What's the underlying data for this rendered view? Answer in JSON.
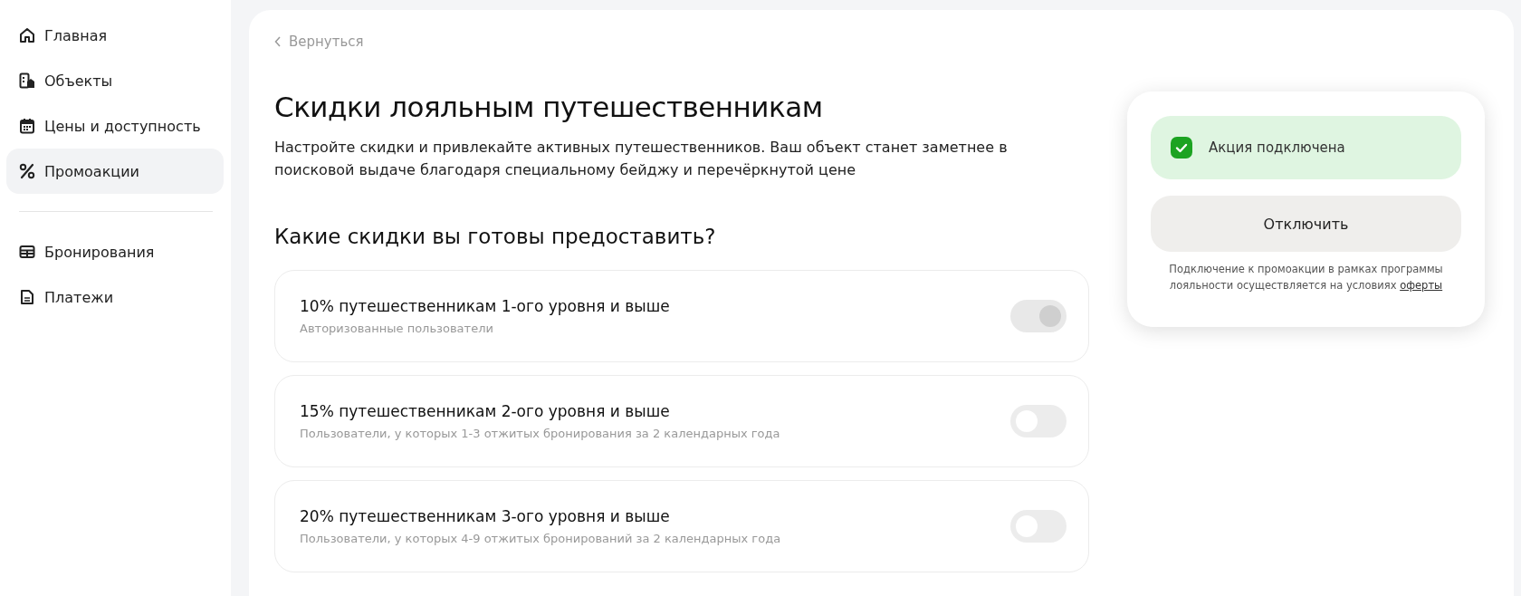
{
  "sidebar": {
    "groups": [
      [
        {
          "label": "Главная",
          "selected": false
        },
        {
          "label": "Объекты",
          "selected": false
        },
        {
          "label": "Цены и доступность",
          "selected": false
        },
        {
          "label": "Промоакции",
          "selected": true
        }
      ],
      [
        {
          "label": "Бронирования",
          "selected": false
        },
        {
          "label": "Платежи",
          "selected": false
        }
      ]
    ]
  },
  "back_link": "Вернуться",
  "title": "Скидки лояльным путешественникам",
  "description": "Настройте скидки и привлекайте активных путешественников. Ваш объект станет заметнее в поисковой выдаче благодаря специальному бейджу и перечёркнутой цене",
  "question": "Какие скидки вы готовы предоставить?",
  "discounts": [
    {
      "title": "10% путешественникам 1-ого уровня и выше",
      "subtitle": "Авторизованные пользователи",
      "checked": true,
      "disabled": true
    },
    {
      "title": "15% путешественникам 2-ого уровня и выше",
      "subtitle": "Пользователи, у которых 1-3 отжитых бронирования за 2 календарных года",
      "checked": false,
      "disabled": false
    },
    {
      "title": "20% путешественникам 3-ого уровня и выше",
      "subtitle": "Пользователи, у которых 4-9 отжитых бронирований за 2 календарных года",
      "checked": false,
      "disabled": false
    }
  ],
  "status": {
    "label": "Акция подключена",
    "connected": true
  },
  "disable_button": "Отключить",
  "terms": {
    "text": "Подключение к промоакции в рамках программы лояльности осуществляется на условиях",
    "link": "оферты"
  }
}
